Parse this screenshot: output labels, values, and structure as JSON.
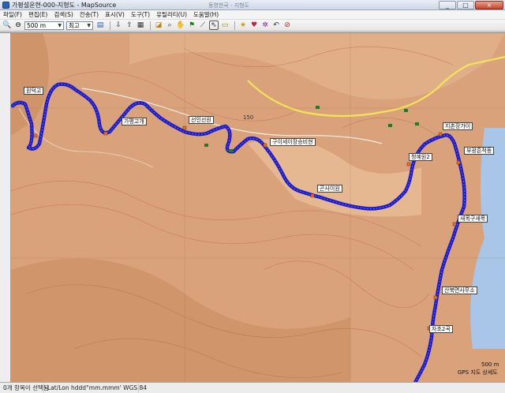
{
  "window": {
    "title": "가평설운현-000-지형도 - MapSource",
    "center_title": "동영한국 - 지형도",
    "controls": {
      "minimize": "_",
      "maximize": "□",
      "close": "×"
    }
  },
  "menu": [
    "파일(F)",
    "편집(E)",
    "검색(S)",
    "전송(T)",
    "표시(V)",
    "도구(T)",
    "유틸리티(U)",
    "도움말(H)"
  ],
  "toolbar": {
    "zoom_value": "500 m",
    "detail_value": "최고",
    "icons": [
      "zoom-in-icon",
      "zoom-out-icon",
      "print-icon",
      "gps-receive-icon",
      "gps-send-icon",
      "track-icon",
      "zoom-tool-icon",
      "hand-tool-icon",
      "waypoint-tool-icon",
      "route-tool-icon",
      "select-tool-icon",
      "measure-tool-icon",
      "map-product-icon",
      "route-icon",
      "track-icon-2",
      "undo-icon"
    ]
  },
  "map": {
    "route_color": "#1a1ac8",
    "waypoints": [
      "원덕고",
      "가평고개",
      "선인선원",
      "구이세이장승비현",
      "곤사이원",
      "청예원2",
      "지촌장가이",
      "부광흔적동",
      "새목구새목",
      "산북면사무소",
      "자초2곡"
    ],
    "road_label": "150",
    "scale": "500 m",
    "product_label": "GPS 지도 상세도"
  },
  "status": {
    "left": "0개 항목이 선택됨",
    "coords": "Lat/Lon hddd°mm.mmm' WGS 84",
    "extra": ""
  }
}
